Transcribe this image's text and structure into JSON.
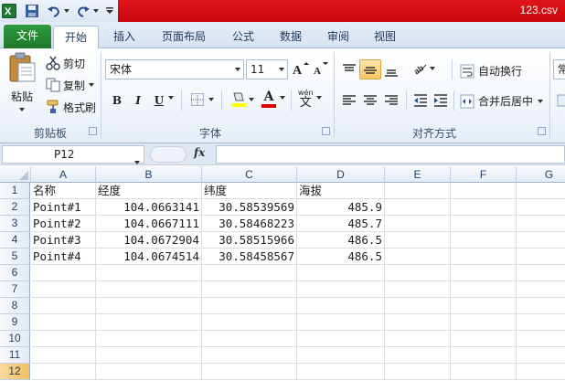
{
  "window": {
    "filename": "123.csv"
  },
  "ribbon_tabs": [
    "文件",
    "开始",
    "插入",
    "页面布局",
    "公式",
    "数据",
    "审阅",
    "视图"
  ],
  "clipboard": {
    "paste": "粘贴",
    "cut": "剪切",
    "copy": "复制",
    "format_painter": "格式刷",
    "label": "剪贴板"
  },
  "font": {
    "name": "宋体",
    "size": "11",
    "label": "字体",
    "bold": "B",
    "italic": "I",
    "underline": "U",
    "font_color_letter": "A",
    "wen": "wén",
    "wen_char": "文"
  },
  "alignment": {
    "wrap_text": "自动换行",
    "merge_center": "合并后居中",
    "label": "对齐方式"
  },
  "number": {
    "partial": "常"
  },
  "formula_bar": {
    "name_box": "P12",
    "fx": "fx",
    "value": ""
  },
  "columns": [
    "A",
    "B",
    "C",
    "D",
    "E",
    "F",
    "G"
  ],
  "rows": [
    "1",
    "2",
    "3",
    "4",
    "5",
    "6",
    "7",
    "8",
    "9",
    "10",
    "11",
    "12"
  ],
  "selected_row": "12",
  "cells": [
    [
      "名称",
      "经度",
      "纬度",
      "海拔"
    ],
    [
      "Point#1",
      "104.0663141",
      "30.58539569",
      "485.9"
    ],
    [
      "Point#2",
      "104.0667111",
      "30.58468223",
      "485.7"
    ],
    [
      "Point#3",
      "104.0672904",
      "30.58515966",
      "486.5"
    ],
    [
      "Point#4",
      "104.0674514",
      "30.58458567",
      "486.5"
    ]
  ],
  "colors": {
    "file_tab": "#1e7a2b",
    "title_bar": "#d00d13",
    "selection": "#f1c15f"
  }
}
